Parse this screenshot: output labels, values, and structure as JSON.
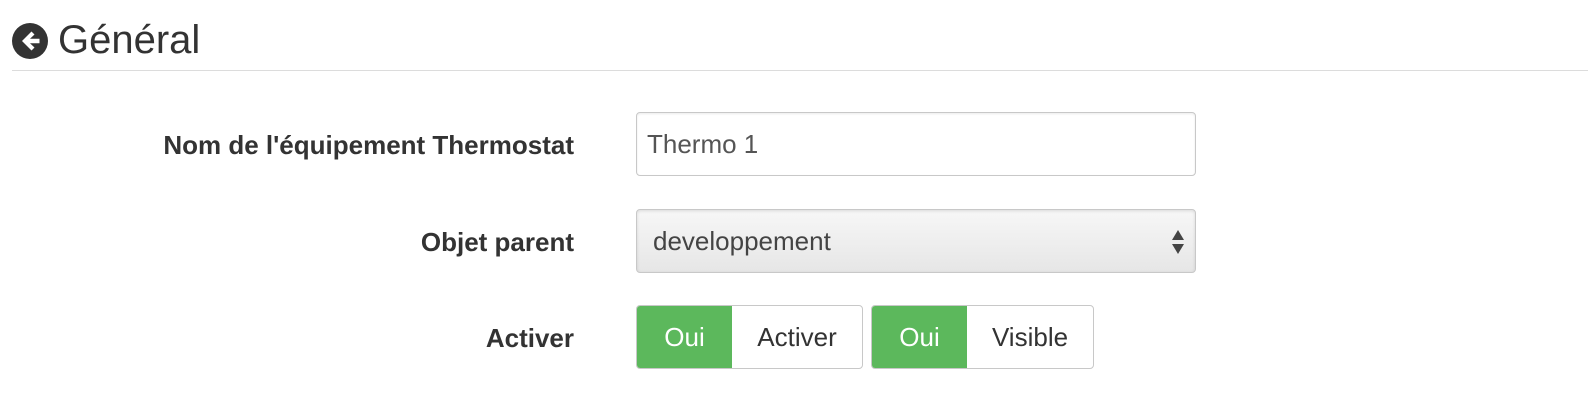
{
  "header": {
    "title": "Général",
    "back_icon": "arrow-circle-left-icon"
  },
  "form": {
    "name": {
      "label": "Nom de l'équipement Thermostat",
      "value": "Thermo 1"
    },
    "parent": {
      "label": "Objet parent",
      "selected": "developpement"
    },
    "activer": {
      "label": "Activer",
      "toggles": [
        {
          "on_label": "Oui",
          "off_label": "Activer"
        },
        {
          "on_label": "Oui",
          "off_label": "Visible"
        }
      ]
    }
  },
  "colors": {
    "toggle_on": "#5cb85c",
    "text": "#333333",
    "border": "#c8c8c8"
  }
}
